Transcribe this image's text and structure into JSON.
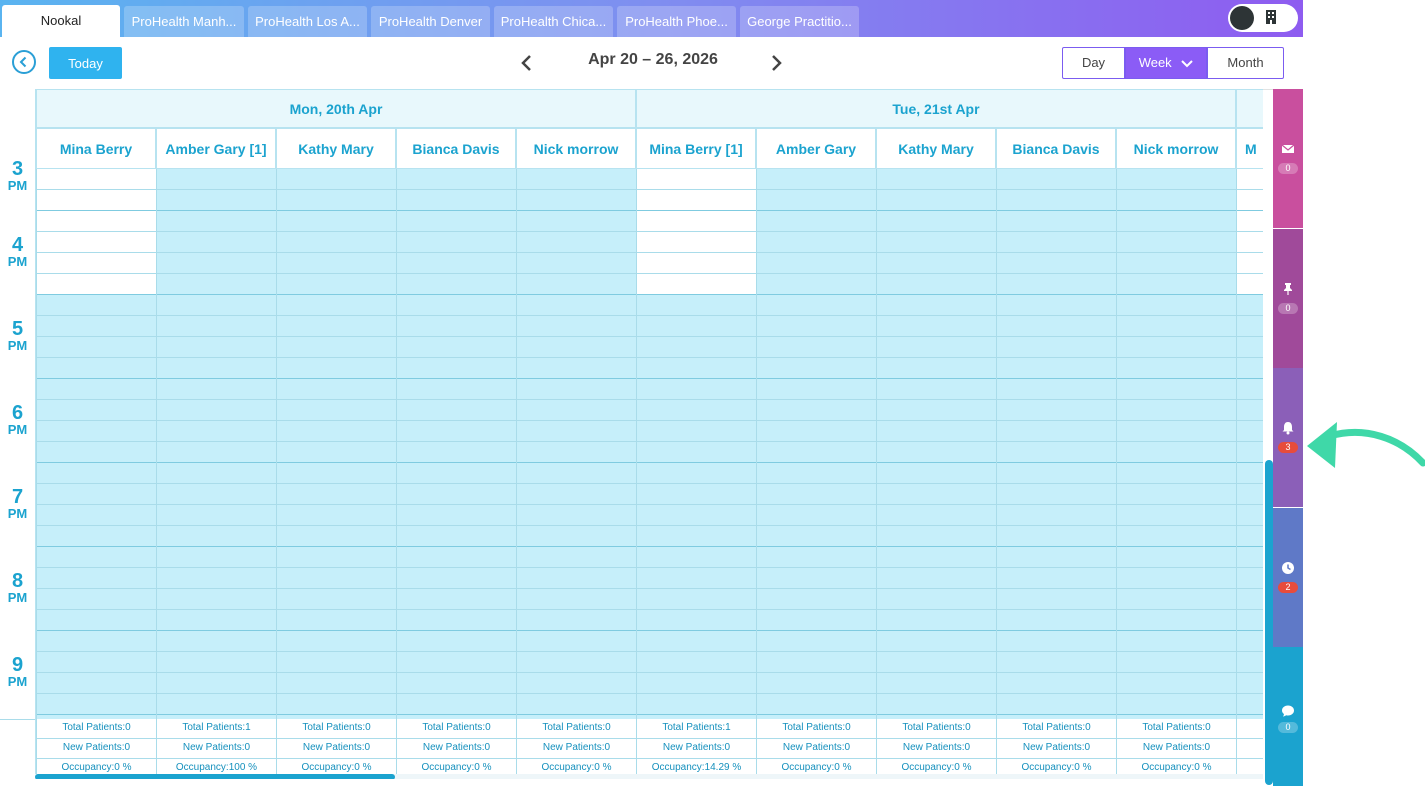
{
  "tabs": [
    {
      "label": "Nookal",
      "active": true
    },
    {
      "label": "ProHealth Manh...",
      "active": false
    },
    {
      "label": "ProHealth Los A...",
      "active": false
    },
    {
      "label": "ProHealth Denver",
      "active": false
    },
    {
      "label": "ProHealth Chica...",
      "active": false
    },
    {
      "label": "ProHealth Phoe...",
      "active": false
    },
    {
      "label": "George Practitio...",
      "active": false
    }
  ],
  "toolbar": {
    "today_label": "Today",
    "date_range": "Apr 20 – 26, 2026",
    "views": [
      "Day",
      "Week",
      "Month"
    ],
    "selected_view": "Week"
  },
  "calendar": {
    "hours": [
      {
        "n": "3",
        "s": "PM"
      },
      {
        "n": "4",
        "s": "PM"
      },
      {
        "n": "5",
        "s": "PM"
      },
      {
        "n": "6",
        "s": "PM"
      },
      {
        "n": "7",
        "s": "PM"
      },
      {
        "n": "8",
        "s": "PM"
      },
      {
        "n": "9",
        "s": "PM"
      }
    ],
    "days": [
      {
        "label": "Mon, 20th Apr",
        "practitioners": [
          {
            "name": "Mina Berry",
            "total": "Total Patients:0",
            "new": "New Patients:0",
            "occ": "Occupancy:0 %",
            "available": true
          },
          {
            "name": "Amber Gary [1]",
            "total": "Total Patients:1",
            "new": "New Patients:0",
            "occ": "Occupancy:100 %",
            "available": false
          },
          {
            "name": "Kathy Mary",
            "total": "Total Patients:0",
            "new": "New Patients:0",
            "occ": "Occupancy:0 %",
            "available": false
          },
          {
            "name": "Bianca Davis",
            "total": "Total Patients:0",
            "new": "New Patients:0",
            "occ": "Occupancy:0 %",
            "available": false
          },
          {
            "name": "Nick morrow",
            "total": "Total Patients:0",
            "new": "New Patients:0",
            "occ": "Occupancy:0 %",
            "available": false
          }
        ]
      },
      {
        "label": "Tue, 21st Apr",
        "practitioners": [
          {
            "name": "Mina Berry [1]",
            "total": "Total Patients:1",
            "new": "New Patients:0",
            "occ": "Occupancy:14.29 %",
            "available": true
          },
          {
            "name": "Amber Gary",
            "total": "Total Patients:0",
            "new": "New Patients:0",
            "occ": "Occupancy:0 %",
            "available": false
          },
          {
            "name": "Kathy Mary",
            "total": "Total Patients:0",
            "new": "New Patients:0",
            "occ": "Occupancy:0 %",
            "available": false
          },
          {
            "name": "Bianca Davis",
            "total": "Total Patients:0",
            "new": "New Patients:0",
            "occ": "Occupancy:0 %",
            "available": false
          },
          {
            "name": "Nick morrow",
            "total": "Total Patients:0",
            "new": "New Patients:0",
            "occ": "Occupancy:0 %",
            "available": false
          }
        ]
      }
    ],
    "partial_next_column": {
      "name": "M",
      "total": "T",
      "new": "N",
      "occ": "O"
    }
  },
  "right_panel": [
    {
      "icon": "envelope-icon",
      "count": "0",
      "color": "#c94f9e",
      "alert": false
    },
    {
      "icon": "pin-icon",
      "count": "0",
      "color": "#a04a9a",
      "alert": false
    },
    {
      "icon": "bell-icon",
      "count": "3",
      "color": "#8b5fb8",
      "alert": true
    },
    {
      "icon": "clock-icon",
      "count": "2",
      "color": "#5f79c7",
      "alert": true
    },
    {
      "icon": "chat-icon",
      "count": "0",
      "color": "#1ba3cf",
      "alert": false
    }
  ]
}
